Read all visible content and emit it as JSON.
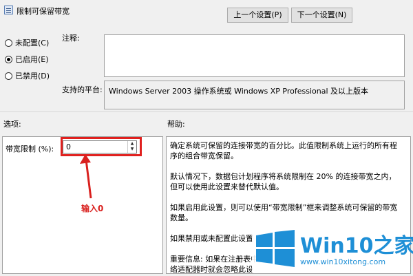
{
  "window": {
    "title": "限制可保留带宽"
  },
  "nav": {
    "prev_label": "上一个设置(P)",
    "next_label": "下一个设置(N)"
  },
  "state": {
    "options": [
      {
        "label": "未配置(C)",
        "checked": false
      },
      {
        "label": "已启用(E)",
        "checked": true
      },
      {
        "label": "已禁用(D)",
        "checked": false
      }
    ]
  },
  "comment": {
    "label": "注释:"
  },
  "platform": {
    "label": "支持的平台:",
    "value": "Windows Server 2003 操作系统或 Windows XP Professional 及以上版本"
  },
  "options_section": {
    "label": "选项:",
    "bandwidth_label": "带宽限制 (%):",
    "bandwidth_value": "0"
  },
  "help_section": {
    "label": "帮助:",
    "paragraphs": [
      "确定系统可保留的连接带宽的百分比。此值限制系统上运行的所有程序的组合带宽保留。",
      "默认情况下，数据包计划程序将系统限制在 20% 的连接带宽之内，但可以使用此设置来替代默认值。",
      "如果启用此设置，则可以使用“带宽限制”框来调整系统可保留的带宽数量。",
      "如果禁用或未配置此设置",
      "重要信息: 如果在注册表中",
      "络适配器时就会忽略此设"
    ]
  },
  "annotation": {
    "text": "输入0",
    "color": "#d9201e"
  },
  "watermark": {
    "brand_a": "Win10",
    "brand_b": "之家",
    "url": "www.win10xitong.com",
    "color": "#1e8fd6"
  }
}
